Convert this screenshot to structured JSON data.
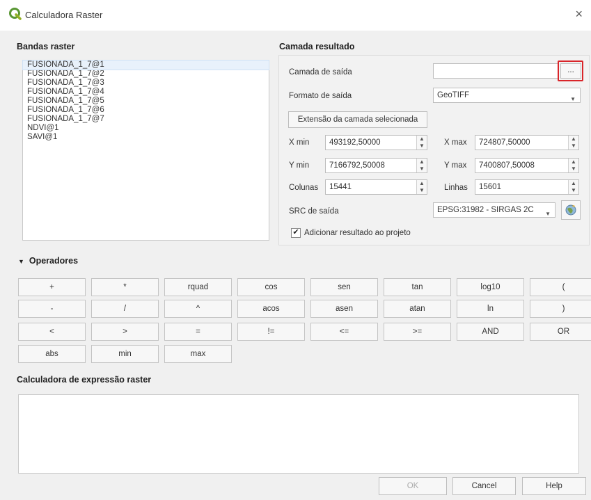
{
  "window": {
    "title": "Calculadora Raster",
    "close_glyph": "×",
    "logo_icon": "qgis-logo-icon"
  },
  "left": {
    "section_title": "Bandas raster",
    "bands": [
      "FUSIONADA_1_7@1",
      "FUSIONADA_1_7@2",
      "FUSIONADA_1_7@3",
      "FUSIONADA_1_7@4",
      "FUSIONADA_1_7@5",
      "FUSIONADA_1_7@6",
      "FUSIONADA_1_7@7",
      "NDVI@1",
      "SAVI@1"
    ]
  },
  "result": {
    "section_title": "Camada resultado",
    "output_layer_label": "Camada de saída",
    "output_layer_value": "",
    "browse_label": "...",
    "format_label": "Formato de saída",
    "format_value": "GeoTIFF",
    "extent_button": "Extensão da camada selecionada",
    "xmin_label": "X min",
    "xmin_value": "493192,50000",
    "xmax_label": "X max",
    "xmax_value": "724807,50000",
    "ymin_label": "Y min",
    "ymin_value": "7166792,50008",
    "ymax_label": "Y max",
    "ymax_value": "7400807,50008",
    "columns_label": "Colunas",
    "columns_value": "15441",
    "rows_label": "Linhas",
    "rows_value": "15601",
    "crs_label": "SRC de saída",
    "crs_value": "EPSG:31982 - SIRGAS 2C",
    "add_to_project_label": "Adicionar resultado ao projeto",
    "add_to_project_checked": true
  },
  "operators": {
    "section_title": "Operadores",
    "rows": [
      [
        "+",
        "*",
        "rquad",
        "cos",
        "sen",
        "tan",
        "log10",
        "("
      ],
      [
        "-",
        "/",
        "^",
        "acos",
        "asen",
        "atan",
        "ln",
        ")"
      ],
      [
        "<",
        ">",
        "=",
        "!=",
        "<=",
        ">=",
        "AND",
        "OR"
      ],
      [
        "abs",
        "min",
        "max"
      ]
    ]
  },
  "expression": {
    "section_title": "Calculadora de expressão raster",
    "value": ""
  },
  "footer": {
    "ok_label": "OK",
    "cancel_label": "Cancel",
    "help_label": "Help"
  },
  "colors": {
    "highlight": "#d9252a",
    "selection": "#e8f1fb"
  }
}
